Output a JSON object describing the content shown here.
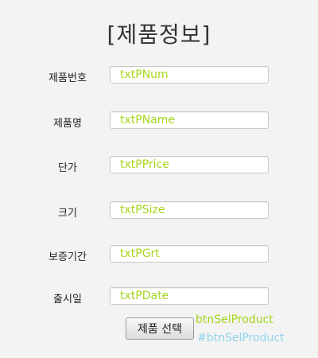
{
  "title": "[제품정보]",
  "fields": [
    {
      "label": "제품번호",
      "value": "txtPNum"
    },
    {
      "label": "제품명",
      "value": "txtPName"
    },
    {
      "label": "단가",
      "value": "txtPPrice"
    },
    {
      "label": "크기",
      "value": "txtPSize"
    },
    {
      "label": "보증기간",
      "value": "txtPGrt"
    },
    {
      "label": "출시일",
      "value": "txtPDate"
    }
  ],
  "select_button": {
    "label": "제품 선택",
    "id_hint": "btnSelProduct",
    "css_hint": "#btnSelProduct"
  },
  "colors": {
    "background": "#f3f3f3",
    "field_text": "#a6d61d",
    "css_hint": "#8fd4ea"
  }
}
